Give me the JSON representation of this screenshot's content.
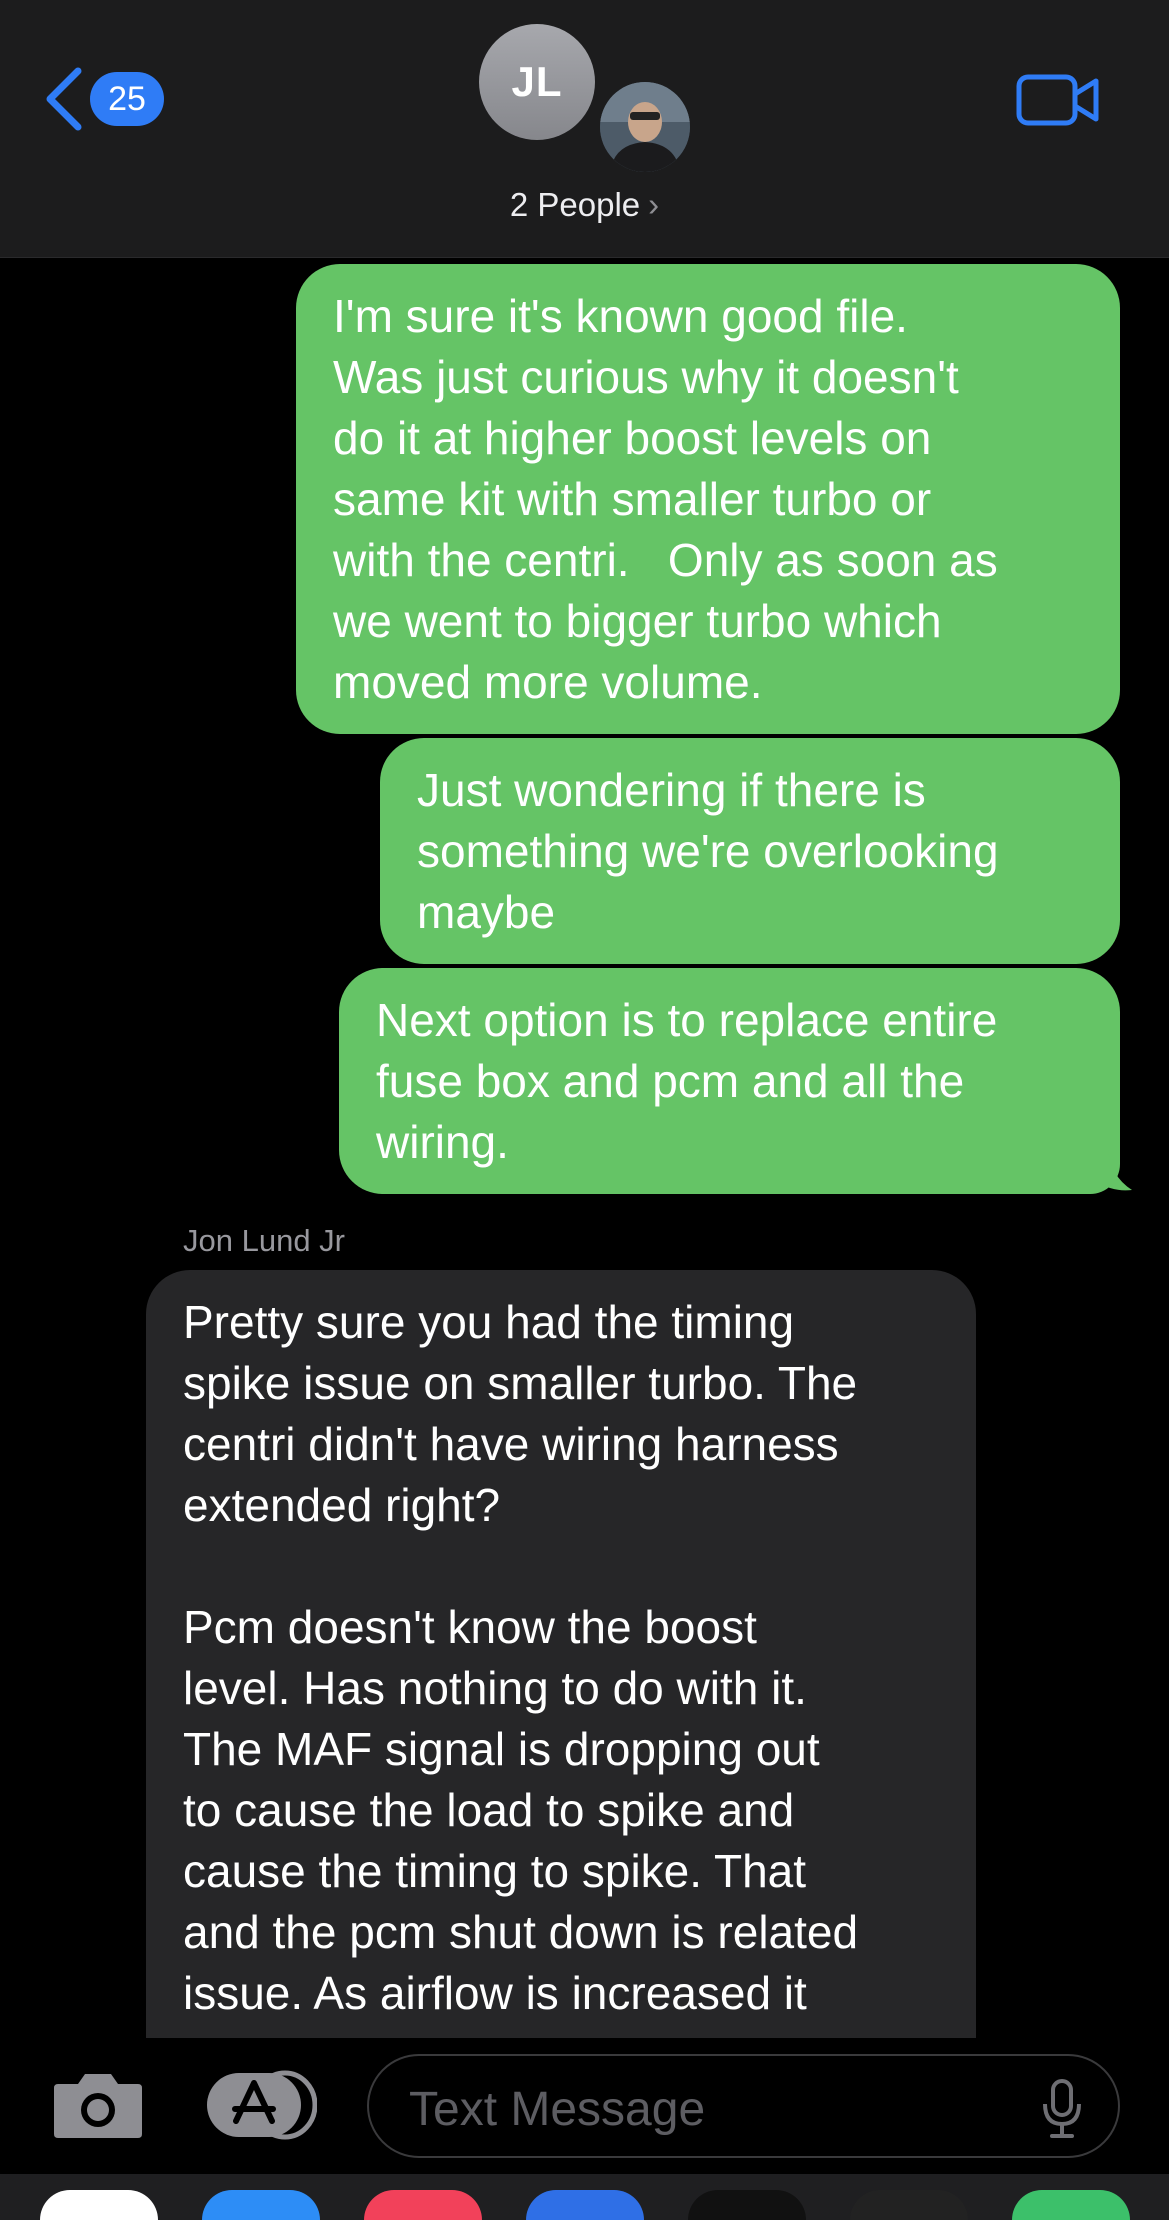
{
  "header": {
    "back_count": "25",
    "avatar_initials": "JL",
    "people_label": "2 People",
    "people_chevron": "›"
  },
  "messages": [
    {
      "type": "sent",
      "text": "I'm sure it's known good file.\nWas just curious why it doesn't\ndo it at higher boost levels on\nsame kit with smaller turbo or\nwith the centri.   Only as soon as\nwe went to bigger turbo which\nmoved more volume."
    },
    {
      "type": "sent",
      "text": "Just wondering if there is\nsomething we're overlooking\nmaybe"
    },
    {
      "type": "sent",
      "text": "Next option is to replace entire\nfuse box and pcm and all the\nwiring."
    },
    {
      "type": "received",
      "sender": "Jon Lund Jr",
      "text": "Pretty sure you had the timing\nspike issue on smaller turbo. The\ncentri didn't have wiring harness\nextended right?\n\nPcm doesn't know the boost\nlevel. Has nothing to do with it.\nThe MAF signal is dropping out\nto cause the load to spike and\ncause the timing to spike. That\nand the pcm shut down is related\nissue. As airflow is increased it"
    }
  ],
  "composer": {
    "placeholder": "Text Message"
  },
  "icons": {
    "back": "chevron-left-icon",
    "video": "video-camera-icon",
    "camera": "camera-icon",
    "apps": "app-store-icon",
    "mic": "microphone-icon"
  },
  "colors": {
    "sent_bubble": "#65c466",
    "received_bubble": "#262628",
    "accent": "#2f7cf6",
    "header_bg": "#1c1c1d"
  }
}
